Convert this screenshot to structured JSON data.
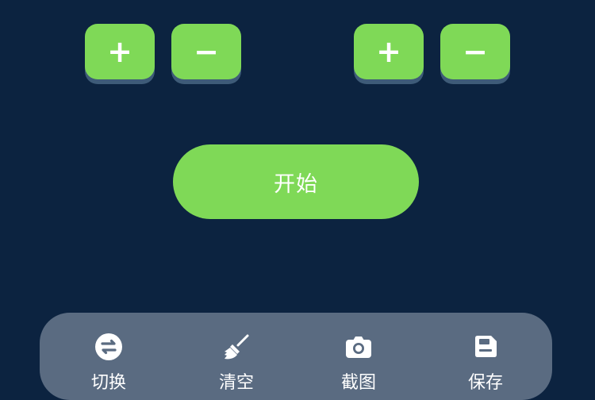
{
  "steppers": {
    "left_plus_label": "+",
    "left_minus_label": "−",
    "right_plus_label": "+",
    "right_minus_label": "−"
  },
  "start_button": {
    "label": "开始"
  },
  "toolbar": {
    "items": [
      {
        "label": "切换",
        "icon": "swap-icon"
      },
      {
        "label": "清空",
        "icon": "broom-icon"
      },
      {
        "label": "截图",
        "icon": "camera-icon"
      },
      {
        "label": "保存",
        "icon": "save-icon"
      }
    ]
  },
  "colors": {
    "background": "#0c2340",
    "accent_green": "#7fd957",
    "panel": "#5a6b81",
    "text": "#ffffff"
  }
}
